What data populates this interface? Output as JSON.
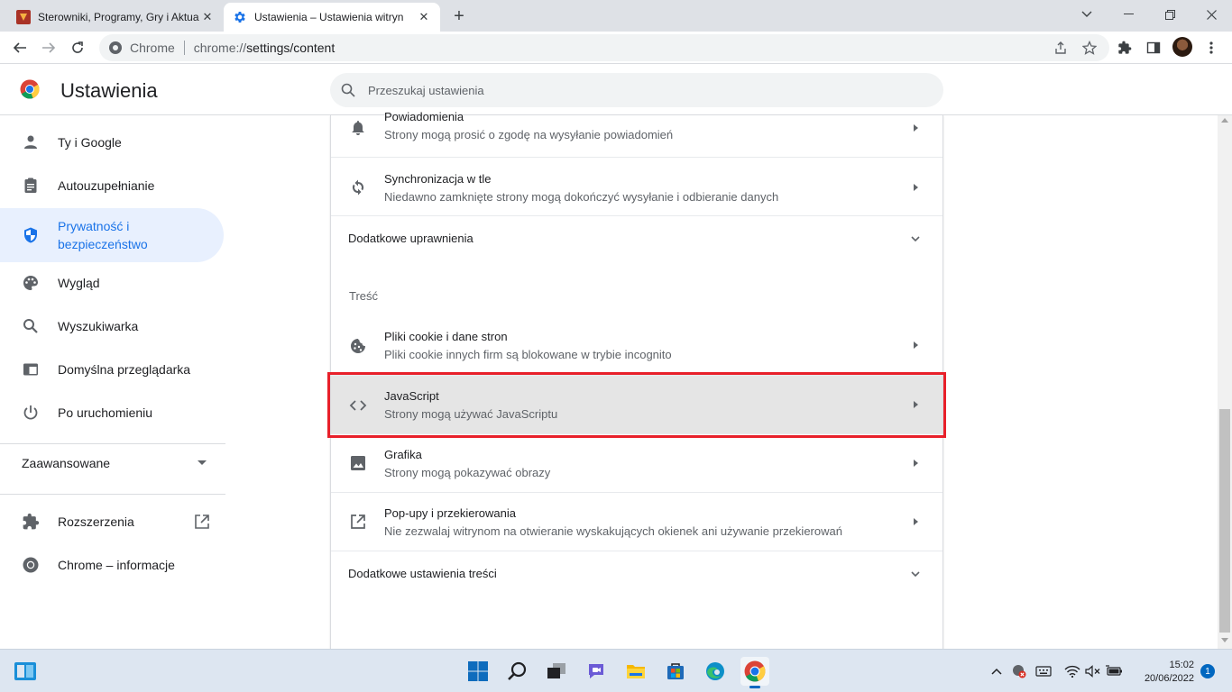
{
  "tabs": [
    {
      "title": "Sterowniki, Programy, Gry i Aktua",
      "active": false
    },
    {
      "title": "Ustawienia – Ustawienia witryn",
      "active": true
    }
  ],
  "toolbar": {
    "site_name": "Chrome",
    "url_scheme": "chrome://",
    "url_rest": "settings/content"
  },
  "header": {
    "title": "Ustawienia",
    "search_placeholder": "Przeszukaj ustawienia"
  },
  "sidebar": {
    "items": [
      {
        "label": "Ty i Google",
        "icon": "person-icon"
      },
      {
        "label": "Autouzupełnianie",
        "icon": "clipboard-icon"
      },
      {
        "label": "Prywatność i bezpieczeństwo",
        "label_line1": "Prywatność i",
        "label_line2": "bezpieczeństwo",
        "icon": "shield-icon",
        "active": true
      },
      {
        "label": "Wygląd",
        "icon": "palette-icon"
      },
      {
        "label": "Wyszukiwarka",
        "icon": "search-icon"
      },
      {
        "label": "Domyślna przeglądarka",
        "icon": "browser-icon"
      },
      {
        "label": "Po uruchomieniu",
        "icon": "power-icon"
      }
    ],
    "advanced_label": "Zaawansowane",
    "extensions_label": "Rozszerzenia",
    "about_label": "Chrome – informacje"
  },
  "content": {
    "rows_top": [
      {
        "title": "Powiadomienia",
        "subtitle": "Strony mogą prosić o zgodę na wysyłanie powiadomień",
        "icon": "bell-icon"
      },
      {
        "title": "Synchronizacja w tle",
        "subtitle": "Niedawno zamknięte strony mogą dokończyć wysyłanie i odbieranie danych",
        "icon": "sync-icon"
      }
    ],
    "additional_permissions": "Dodatkowe uprawnienia",
    "section_title": "Treść",
    "rows_content": [
      {
        "title": "Pliki cookie i dane stron",
        "subtitle": "Pliki cookie innych firm są blokowane w trybie incognito",
        "icon": "cookie-icon"
      },
      {
        "title": "JavaScript",
        "subtitle": "Strony mogą używać JavaScriptu",
        "icon": "code-icon",
        "highlighted": true
      },
      {
        "title": "Grafika",
        "subtitle": "Strony mogą pokazywać obrazy",
        "icon": "image-icon"
      },
      {
        "title": "Pop-upy i przekierowania",
        "subtitle": "Nie zezwalaj witrynom na otwieranie wyskakujących okienek ani używanie przekierowań",
        "icon": "open-in-new-icon"
      }
    ],
    "additional_content_settings": "Dodatkowe ustawienia treści"
  },
  "taskbar": {
    "time": "15:02",
    "date": "20/06/2022",
    "notifications": "1"
  },
  "colors": {
    "accent": "#1a73e8",
    "active_bg": "#e8f0fe",
    "highlight_border": "#e8202a",
    "highlight_row_bg": "#e5e5e5"
  }
}
